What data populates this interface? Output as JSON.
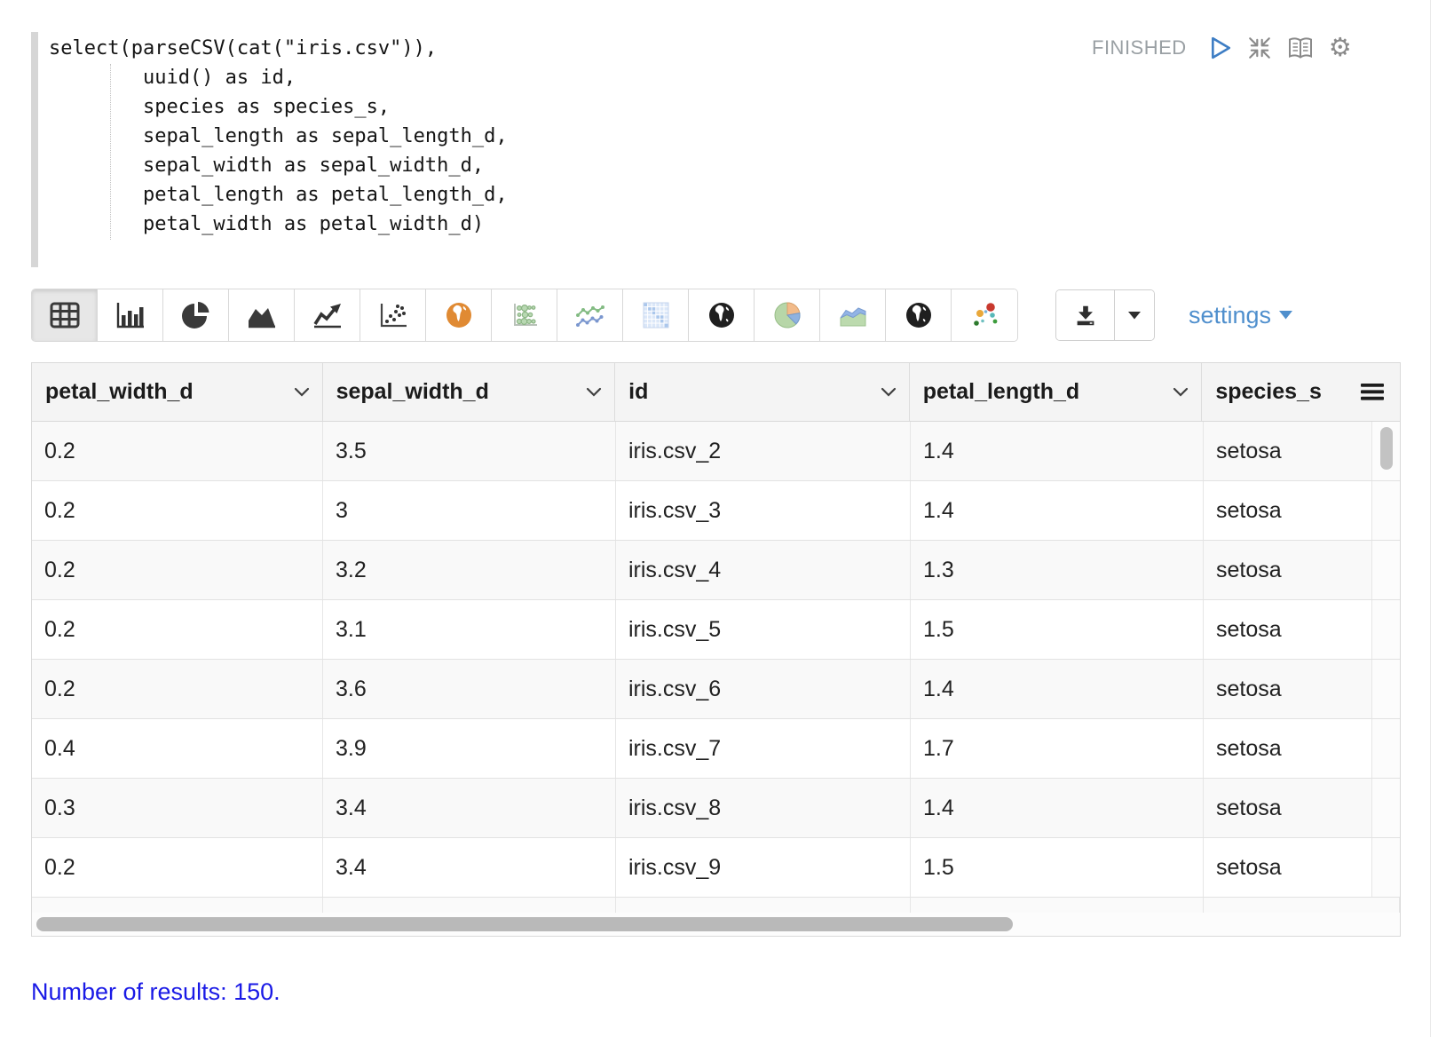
{
  "code": {
    "text": "select(parseCSV(cat(\"iris.csv\")),\n        uuid() as id,\n        species as species_s,\n        sepal_length as sepal_length_d,\n        sepal_width as sepal_width_d,\n        petal_length as petal_length_d,\n        petal_width as petal_width_d)"
  },
  "status": {
    "label": "FINISHED"
  },
  "paragraph_controls": {
    "icons": [
      "run-play-icon",
      "collapse-icon",
      "book-icon",
      "gear-icon"
    ]
  },
  "toolbar": {
    "chart_buttons": [
      {
        "name": "table",
        "active": true
      },
      {
        "name": "bar-chart",
        "active": false
      },
      {
        "name": "pie-chart",
        "active": false
      },
      {
        "name": "area-chart",
        "active": false
      },
      {
        "name": "line-chart",
        "active": false
      },
      {
        "name": "scatter-chart",
        "active": false
      },
      {
        "name": "map-orange-globe",
        "active": false
      },
      {
        "name": "bubble-chart",
        "active": false
      },
      {
        "name": "multi-line-chart",
        "active": false
      },
      {
        "name": "heatmap",
        "active": false
      },
      {
        "name": "globe-map",
        "active": false
      },
      {
        "name": "pie-chart-color",
        "active": false
      },
      {
        "name": "area-chart-color",
        "active": false
      },
      {
        "name": "globe-map-2",
        "active": false
      },
      {
        "name": "scatter-chart-color",
        "active": false
      }
    ],
    "download_icon": "download-icon",
    "settings_label": "settings"
  },
  "table": {
    "columns": [
      {
        "label": "petal_width_d",
        "has_chevron": true
      },
      {
        "label": "sepal_width_d",
        "has_chevron": true
      },
      {
        "label": "id",
        "has_chevron": true
      },
      {
        "label": "petal_length_d",
        "has_chevron": true
      },
      {
        "label": "species_s",
        "has_chevron": false
      }
    ],
    "rows": [
      [
        "0.2",
        "3.5",
        "iris.csv_2",
        "1.4",
        "setosa"
      ],
      [
        "0.2",
        "3",
        "iris.csv_3",
        "1.4",
        "setosa"
      ],
      [
        "0.2",
        "3.2",
        "iris.csv_4",
        "1.3",
        "setosa"
      ],
      [
        "0.2",
        "3.1",
        "iris.csv_5",
        "1.5",
        "setosa"
      ],
      [
        "0.2",
        "3.6",
        "iris.csv_6",
        "1.4",
        "setosa"
      ],
      [
        "0.4",
        "3.9",
        "iris.csv_7",
        "1.7",
        "setosa"
      ],
      [
        "0.3",
        "3.4",
        "iris.csv_8",
        "1.4",
        "setosa"
      ],
      [
        "0.2",
        "3.4",
        "iris.csv_9",
        "1.5",
        "setosa"
      ]
    ]
  },
  "footer": {
    "results_label": "Number of results: 150."
  },
  "colors": {
    "settings_blue": "#4f8fcd",
    "results_blue": "#1a1ae6",
    "status_gray": "#9aa0a4",
    "play_blue": "#3d7dc4",
    "orange_globe": "#e08a33",
    "header_bg": "#f4f4f4",
    "row_stripe": "#f9f9f9"
  }
}
